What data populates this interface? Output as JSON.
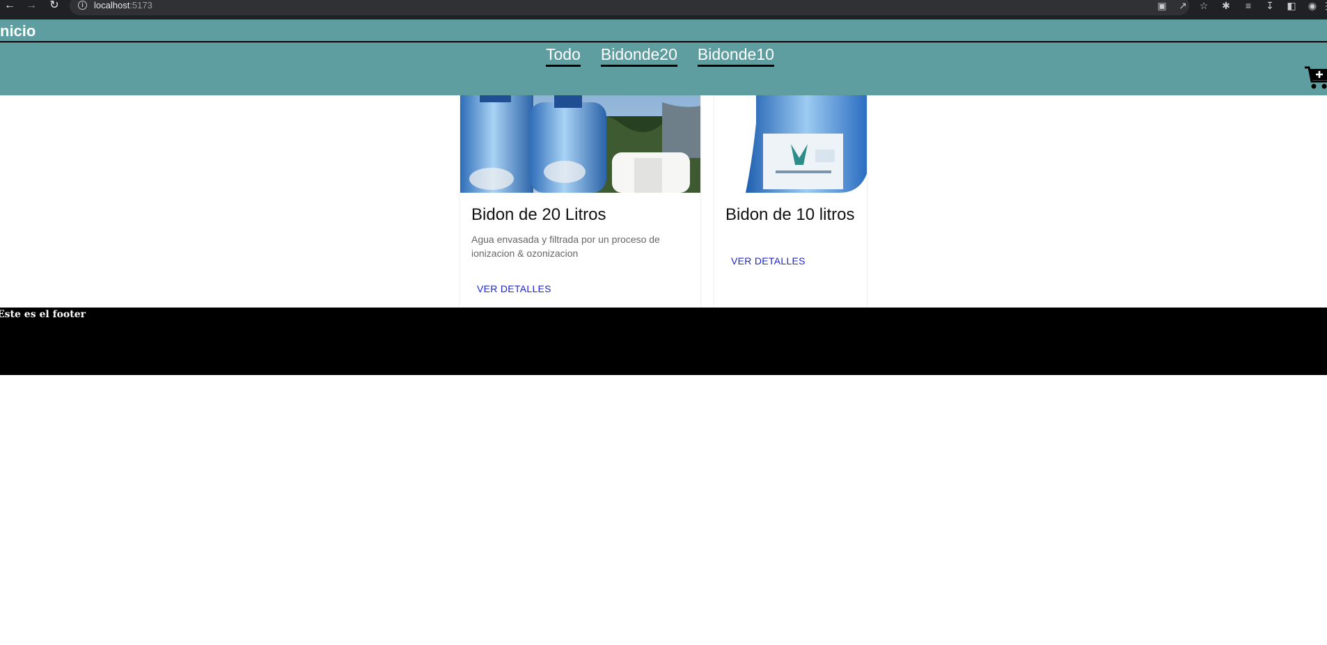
{
  "browser": {
    "url_host": "localhost",
    "url_port": ":5173"
  },
  "header": {
    "brand": "nicio"
  },
  "nav": {
    "tabs": [
      "Todo",
      "Bidonde20",
      "Bidonde10"
    ]
  },
  "products": [
    {
      "title": "Bidon de 20 Litros",
      "description": "Agua envasada y filtrada por un proceso de ionizacion & ozonizacion",
      "button": "VER DETALLES"
    },
    {
      "title": "Bidon de 10 litros",
      "description": "",
      "button": "VER DETALLES"
    }
  ],
  "footer": {
    "text": "Este es el footer"
  },
  "colors": {
    "header_bg": "#5f9ea0",
    "footer_bg": "#000000",
    "link": "#1a23d6"
  }
}
